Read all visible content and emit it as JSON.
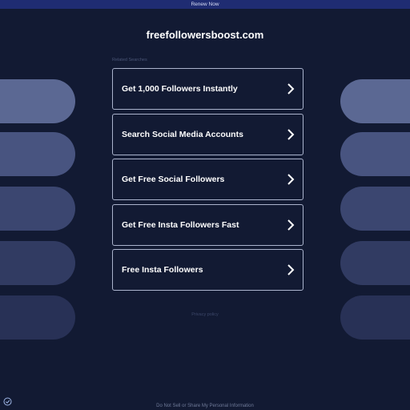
{
  "topbar": {
    "renew_label": "Renew Now"
  },
  "domain": "freefollowersboost.com",
  "related_label": "Related Searches",
  "links": [
    {
      "label": "Get 1,000 Followers Instantly"
    },
    {
      "label": "Search Social Media Accounts"
    },
    {
      "label": "Get Free Social Followers"
    },
    {
      "label": "Get Free Insta Followers Fast"
    },
    {
      "label": "Free Insta Followers"
    }
  ],
  "privacy_label": "Privacy policy",
  "footer_label": "Do Not Sell or Share My Personal Information",
  "icons": {
    "link_arrow": "chevron-right-icon",
    "privacy_badge": "privacy-options-icon"
  },
  "colors": {
    "background": "#121a33",
    "topbar": "#1f2c72",
    "link_border": "#aab3cc",
    "pill_gradient": [
      "#5b6893",
      "#485480",
      "#3b4670",
      "#313b62",
      "#283156"
    ]
  }
}
